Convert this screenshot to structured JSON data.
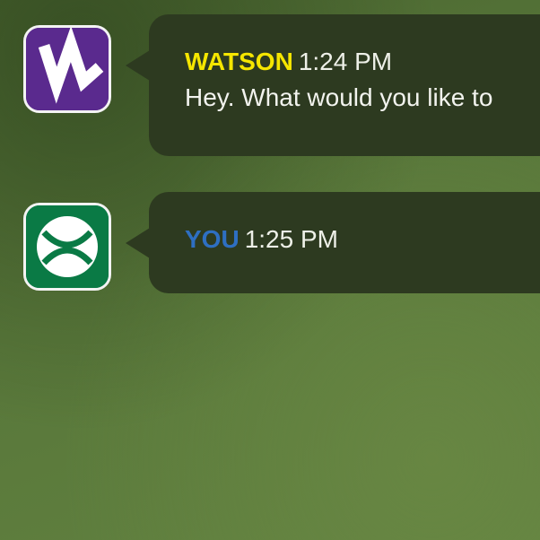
{
  "colors": {
    "bubble_bg": "#2d3a20",
    "watson_name": "#f5e600",
    "you_name": "#2e6fc2",
    "watson_avatar": "#5a2a8e",
    "you_avatar": "#0a7a45",
    "text": "#f2f3ee"
  },
  "messages": [
    {
      "sender": "WATSON",
      "time": "1:24 PM",
      "text": "Hey. What would you like to",
      "avatar_icon": "watson-w-logo-icon"
    },
    {
      "sender": "YOU",
      "time": "1:25 PM",
      "text": "",
      "avatar_icon": "tennis-ball-icon"
    }
  ]
}
